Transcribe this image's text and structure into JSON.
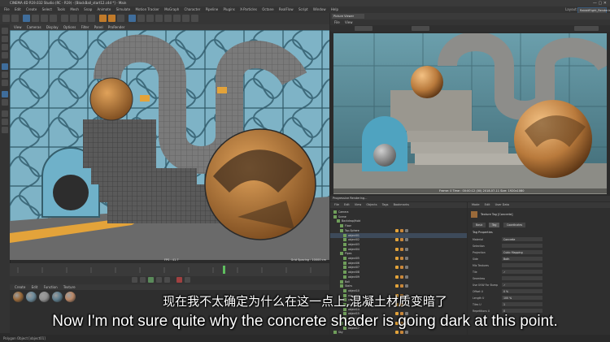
{
  "window": {
    "title": "CINEMA 4D R19.032 Studio (RC - R19) - [BlockBall_start12.c4d *] - Main",
    "controls": "—  ▢  ✕",
    "menus": [
      "File",
      "Edit",
      "Create",
      "Select",
      "Tools",
      "Mesh",
      "Snap",
      "Animate",
      "Simulate",
      "Motion Tracker",
      "MoGraph",
      "Character",
      "Pipeline",
      "Plugins",
      "X-Particles",
      "Octane",
      "RealFlow",
      "Script",
      "Window",
      "Help"
    ],
    "layout_label": "Layout:",
    "layout_value": "RabbitRight_Rendering_Shared"
  },
  "viewport": {
    "menus": [
      "View",
      "Cameras",
      "Display",
      "Options",
      "Filter",
      "Panel",
      "ProRender"
    ],
    "status_left": "FPS : 41.7",
    "status_right": "Grid Spacing : 10000 cm"
  },
  "picture_viewer": {
    "tab": "Picture Viewer",
    "menus": [
      "File",
      "View"
    ],
    "render_info": "Frame: 0   Time : 00:00:12 (00)   2018-07-11   Size: 1920x1080",
    "progress_label": "Progressive Rendering..."
  },
  "object_manager": {
    "menus": [
      "File",
      "Edit",
      "View",
      "Objects",
      "Tags",
      "Bookmarks"
    ],
    "rows": [
      "Camera",
      "Scene",
      "Backdrop/Hold",
      "Floor",
      "Top-Sphere",
      "object01",
      "object02",
      "object03",
      "object04",
      "Pipes",
      "object05",
      "object06",
      "object07",
      "object08",
      "object09",
      "Ball",
      "Stairs",
      "object10",
      "object11",
      "object12",
      "object13",
      "object14",
      "object15",
      "object16",
      "Fence",
      "object17",
      "Sky"
    ]
  },
  "attributes": {
    "menus": [
      "Mode",
      "Edit",
      "User Data"
    ],
    "header": "Texture Tag [Concrete]",
    "tabs": [
      "Basic",
      "Tag",
      "Coordinates"
    ],
    "section": "Tag Properties",
    "rows": [
      {
        "label": "Material",
        "value": "Concrete"
      },
      {
        "label": "Selection",
        "value": ""
      },
      {
        "label": "Projection",
        "value": "Cubic Mapping"
      },
      {
        "label": "Side",
        "value": "Both"
      },
      {
        "label": "Mix Textures",
        "value": ""
      },
      {
        "label": "Tile",
        "value": "✓"
      },
      {
        "label": "Seamless",
        "value": ""
      },
      {
        "label": "Use UVW For Bump",
        "value": "✓"
      },
      {
        "label": "Offset U",
        "value": "0 %"
      },
      {
        "label": "Length U",
        "value": "100 %"
      },
      {
        "label": "Tiles U",
        "value": "1"
      },
      {
        "label": "Repetitions U",
        "value": "0"
      }
    ]
  },
  "materials": {
    "menus": [
      "Create",
      "Edit",
      "Function",
      "Texture"
    ],
    "colors": [
      "#9a6a3a",
      "#6c8a9a",
      "#8f8f8f",
      "#5e7e8e",
      "#b98766"
    ]
  },
  "statusbar": "Polygon Object [object01]",
  "subtitles": {
    "cn": "现在我不太确定为什么在这一点上,混凝土材质变暗了",
    "en": "Now I'm not sure quite why the concrete shader is going dark at this point."
  }
}
